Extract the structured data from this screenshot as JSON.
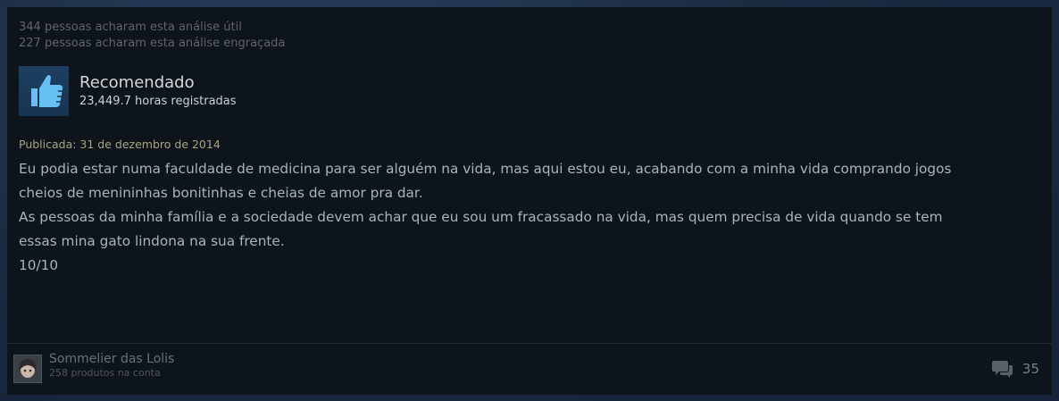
{
  "review": {
    "helpful_text": "344 pessoas acharam esta análise útil",
    "funny_text": "227 pessoas acharam esta análise engraçada",
    "verdict": "Recomendado",
    "hours": "23,449.7 horas registradas",
    "posted": "Publicada: 31 de dezembro de 2014",
    "body": [
      "Eu podia estar numa faculdade de medicina para ser alguém na vida, mas aqui estou eu, acabando com a minha vida comprando jogos",
      "cheios de menininhas bonitinhas e cheias de amor pra dar.",
      "As pessoas da minha família e a sociedade devem achar que eu sou um fracassado na vida, mas quem precisa de vida quando se tem",
      "essas mina gato lindona na sua frente.",
      "10/10"
    ],
    "thumb_icon": "thumbs-up-icon"
  },
  "author": {
    "name": "Sommelier das Lolis",
    "products": "258 produtos na conta",
    "avatar_icon": "avatar"
  },
  "comments": {
    "count": "35",
    "icon": "comments-icon"
  },
  "colors": {
    "card_bg": "#0e141b",
    "thumb_bg": "#1e3f61",
    "thumb_fg": "#66c0f4",
    "posted": "#a9a47e",
    "body": "#acb2b8"
  }
}
